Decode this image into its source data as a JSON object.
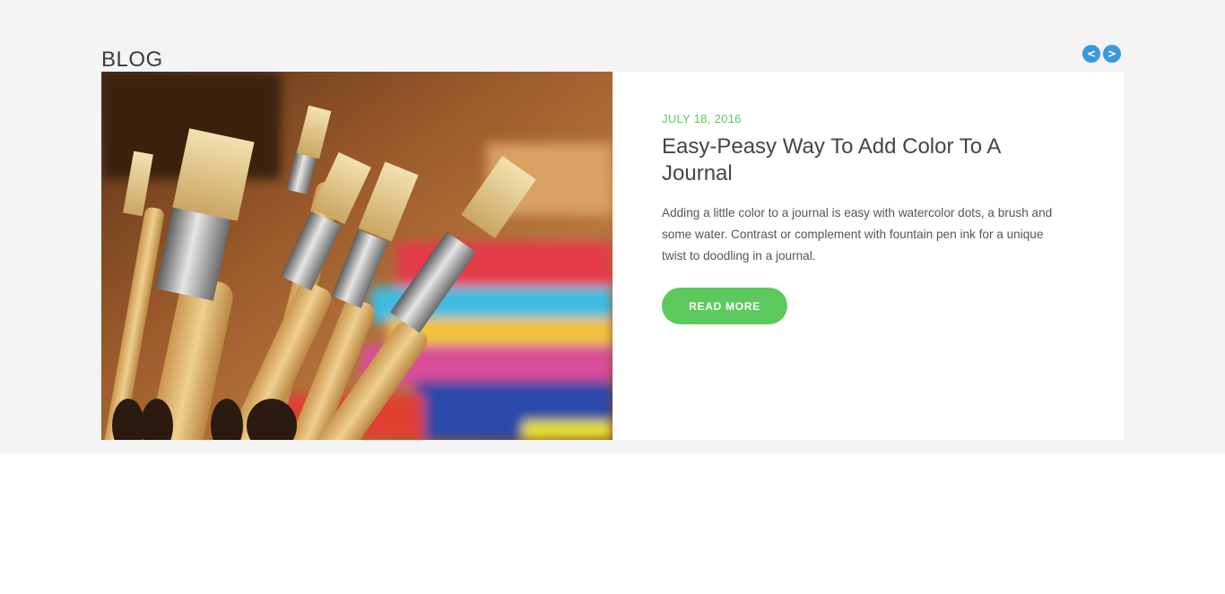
{
  "section": {
    "title": "BLOG",
    "nav": {
      "prev_label": "<",
      "next_label": ">"
    }
  },
  "post": {
    "date": "JULY 18, 2016",
    "title": "Easy-Peasy Way To Add Color To A Journal",
    "excerpt": "Adding a little color to a journal is easy with watercolor dots, a brush and some water. Contrast or complement with fountain pen ink for a unique twist to doodling in a journal.",
    "read_more_label": "READ MORE",
    "image_alt": "paint-brushes-photo"
  },
  "colors": {
    "accent_green": "#5cc95c",
    "nav_blue": "#3a9ad9",
    "section_bg": "#f4f4f4"
  }
}
